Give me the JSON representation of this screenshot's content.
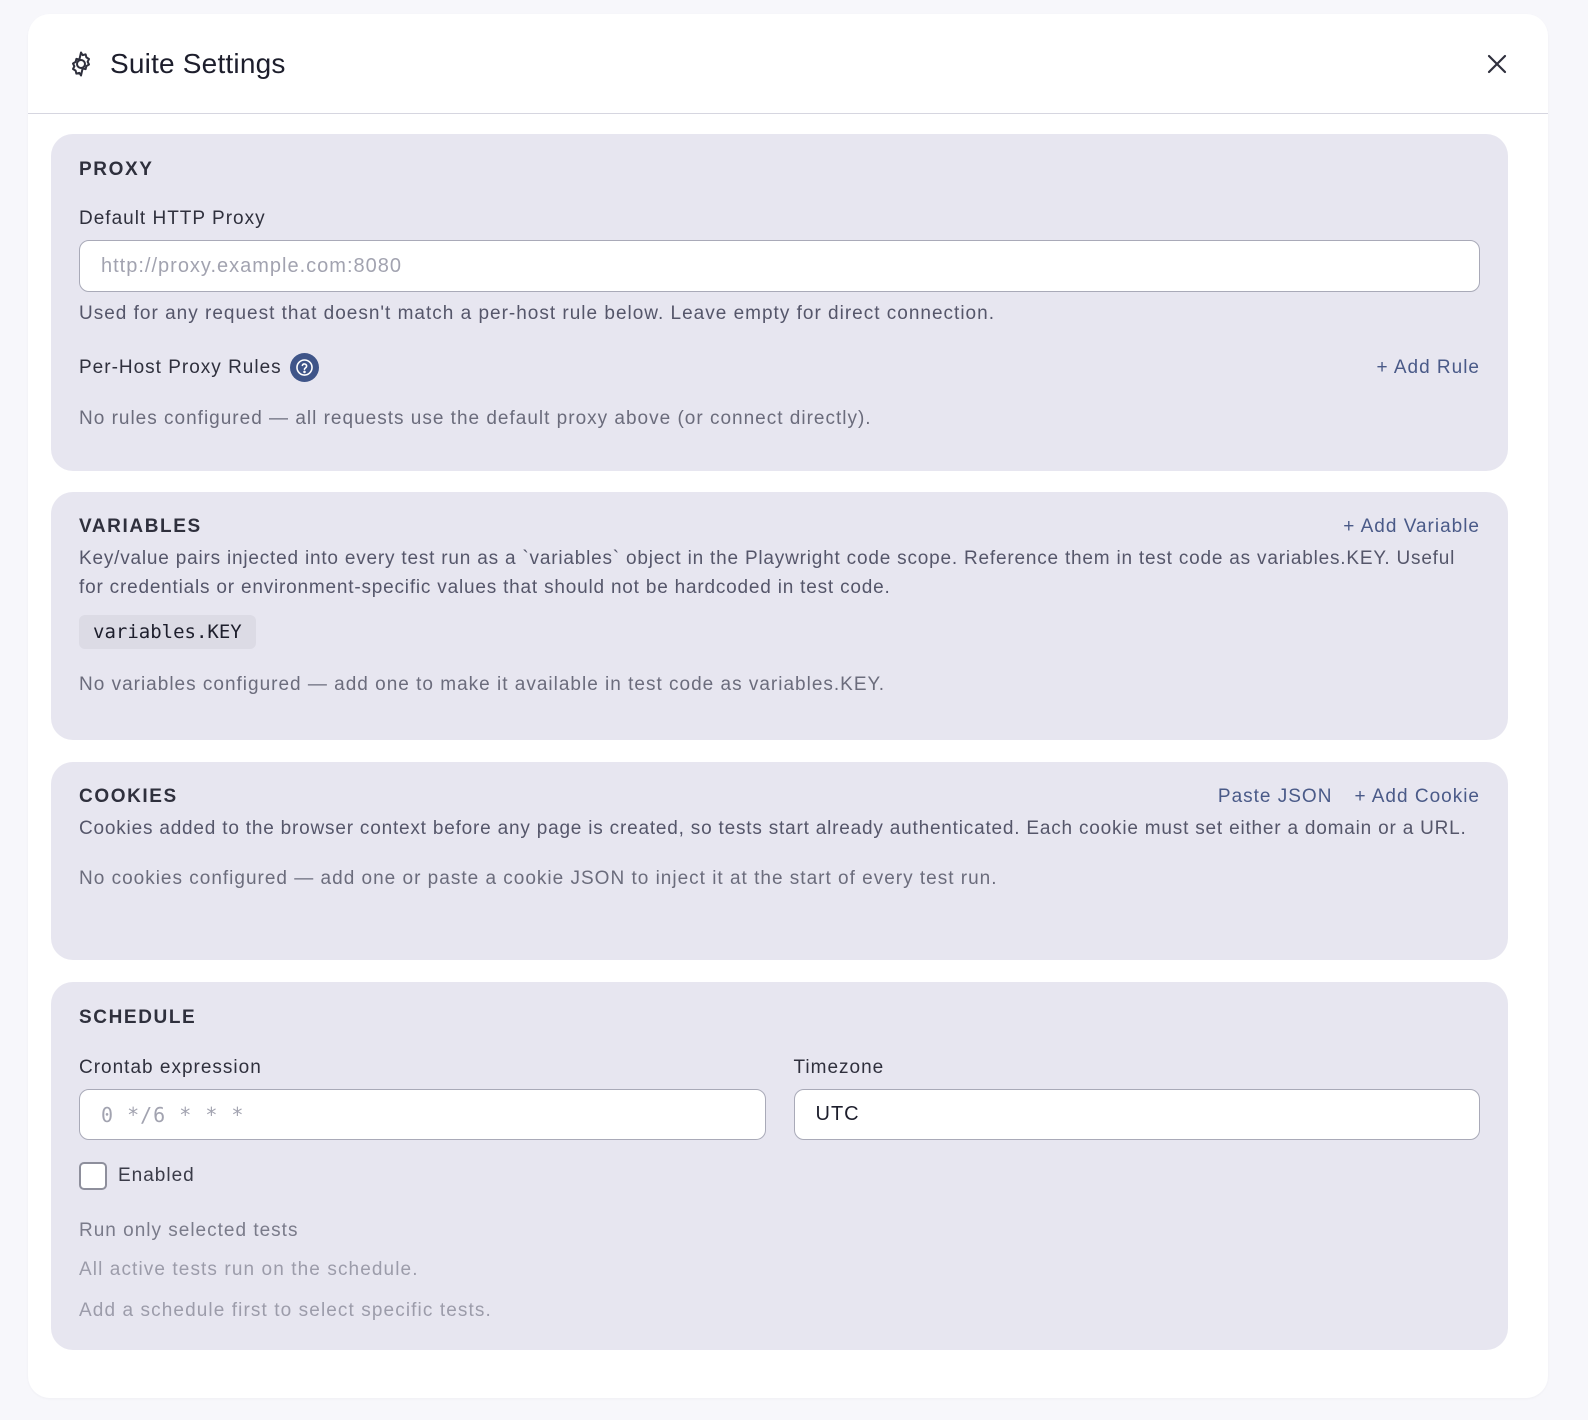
{
  "header": {
    "title": "Suite Settings",
    "icon": "gear-icon",
    "close_icon": "close-icon"
  },
  "proxy": {
    "title": "PROXY",
    "default_label": "Default HTTP Proxy",
    "default_placeholder": "http://proxy.example.com:8080",
    "default_value": "",
    "default_help": "Used for any request that doesn't match a per-host rule below. Leave empty for direct connection.",
    "rules_label": "Per-Host Proxy Rules",
    "rules_help_icon": "question-circle-icon",
    "add_rule": "+ Add Rule",
    "empty": "No rules configured — all requests use the default proxy above (or connect directly)."
  },
  "variables": {
    "title": "VARIABLES",
    "add": "+ Add Variable",
    "description": "Key/value pairs injected into every test run as a `variables` object in the Playwright code scope. Reference them in test code as variables.KEY. Useful for credentials or environment-specific values that should not be hardcoded in test code.",
    "code_example": "variables.KEY",
    "empty": "No variables configured — add one to make it available in test code as variables.KEY."
  },
  "cookies": {
    "title": "COOKIES",
    "paste_json": "Paste JSON",
    "add": "+ Add Cookie",
    "description": "Cookies added to the browser context before any page is created, so tests start already authenticated. Each cookie must set either a domain or a URL.",
    "empty": "No cookies configured — add one or paste a cookie JSON to inject it at the start of every test run."
  },
  "schedule": {
    "title": "SCHEDULE",
    "crontab_label": "Crontab expression",
    "crontab_placeholder": "0 */6 * * *",
    "crontab_value": "",
    "timezone_label": "Timezone",
    "timezone_value": "UTC",
    "enabled_label": "Enabled",
    "enabled_checked": false,
    "run_selected_label": "Run only selected tests",
    "run_selected_help": "All active tests run on the schedule.",
    "run_selected_note": "Add a schedule first to select specific tests."
  },
  "colors": {
    "section_bg": "#e7e6f0",
    "link": "#4a5a88",
    "help_icon_bg": "#3f5589"
  }
}
